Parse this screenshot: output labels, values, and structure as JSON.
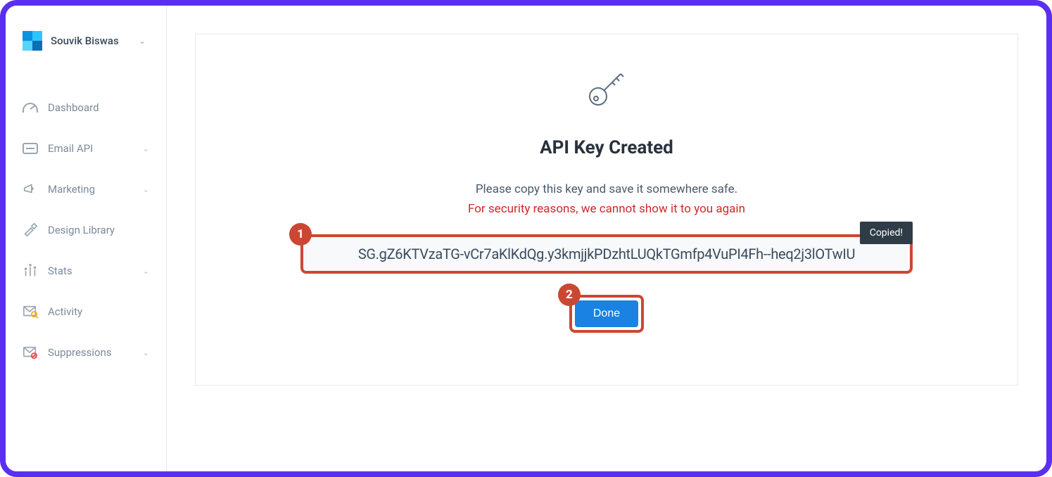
{
  "account": {
    "name": "Souvik Biswas"
  },
  "sidebar": {
    "items": [
      {
        "label": "Dashboard",
        "icon": "gauge-icon",
        "expandable": false
      },
      {
        "label": "Email API",
        "icon": "card-icon",
        "expandable": true
      },
      {
        "label": "Marketing",
        "icon": "megaphone-icon",
        "expandable": true
      },
      {
        "label": "Design Library",
        "icon": "design-icon",
        "expandable": false
      },
      {
        "label": "Stats",
        "icon": "stats-icon",
        "expandable": true
      },
      {
        "label": "Activity",
        "icon": "activity-icon",
        "expandable": false
      },
      {
        "label": "Suppressions",
        "icon": "suppressions-icon",
        "expandable": true
      }
    ]
  },
  "panel": {
    "title": "API Key Created",
    "subtitle": "Please copy this key and save it somewhere safe.",
    "warning": "For security reasons, we cannot show it to you again",
    "api_key": "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",
    "done_label": "Done",
    "tooltip": "Copied!"
  },
  "annotations": {
    "step1": "1",
    "step2": "2"
  },
  "colors": {
    "frame_border": "#5b2ff0",
    "highlight_border": "#cc4733",
    "warning_text": "#cc2a2a",
    "primary_button": "#1a82e2"
  }
}
